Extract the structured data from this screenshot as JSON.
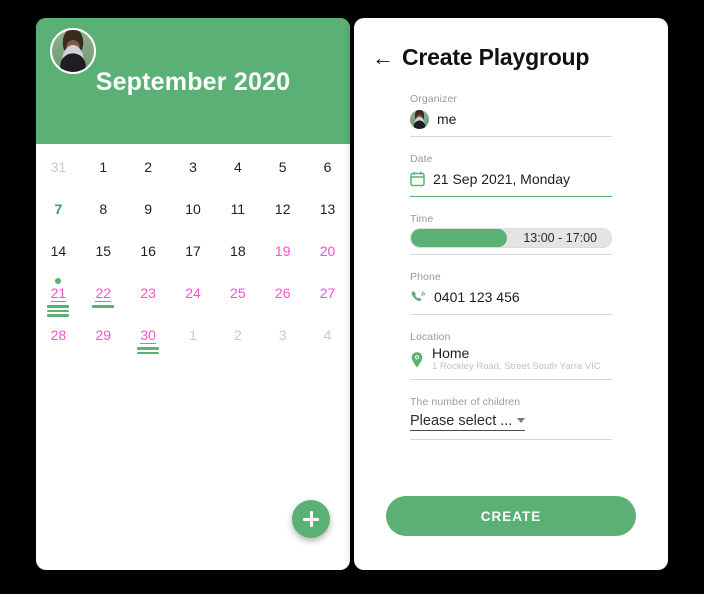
{
  "calendar": {
    "month_title": "September 2020",
    "avatar_name": "organizer-avatar",
    "add_button_label": "+",
    "weeks": [
      [
        {
          "n": "31",
          "style": "muted"
        },
        {
          "n": "1",
          "style": "normal"
        },
        {
          "n": "2",
          "style": "normal"
        },
        {
          "n": "3",
          "style": "normal"
        },
        {
          "n": "4",
          "style": "normal"
        },
        {
          "n": "5",
          "style": "normal"
        },
        {
          "n": "6",
          "style": "normal"
        }
      ],
      [
        {
          "n": "7",
          "style": "green"
        },
        {
          "n": "8",
          "style": "normal"
        },
        {
          "n": "9",
          "style": "normal"
        },
        {
          "n": "10",
          "style": "normal"
        },
        {
          "n": "11",
          "style": "normal"
        },
        {
          "n": "12",
          "style": "normal"
        },
        {
          "n": "13",
          "style": "normal"
        }
      ],
      [
        {
          "n": "14",
          "style": "normal"
        },
        {
          "n": "15",
          "style": "normal"
        },
        {
          "n": "16",
          "style": "normal"
        },
        {
          "n": "17",
          "style": "normal"
        },
        {
          "n": "18",
          "style": "normal"
        },
        {
          "n": "19",
          "style": "pink"
        },
        {
          "n": "20",
          "style": "pink"
        }
      ],
      [
        {
          "n": "21",
          "style": "pink",
          "underline": true,
          "dot": true,
          "bars": 3
        },
        {
          "n": "22",
          "style": "pink",
          "underline": true,
          "bars": 1
        },
        {
          "n": "23",
          "style": "pink"
        },
        {
          "n": "24",
          "style": "pink"
        },
        {
          "n": "25",
          "style": "pink"
        },
        {
          "n": "26",
          "style": "pink"
        },
        {
          "n": "27",
          "style": "pink"
        }
      ],
      [
        {
          "n": "28",
          "style": "pink"
        },
        {
          "n": "29",
          "style": "pink"
        },
        {
          "n": "30",
          "style": "pink",
          "underline": true,
          "bars": 2
        },
        {
          "n": "1",
          "style": "muted"
        },
        {
          "n": "2",
          "style": "muted"
        },
        {
          "n": "3",
          "style": "muted"
        },
        {
          "n": "4",
          "style": "muted"
        }
      ]
    ]
  },
  "form": {
    "back_label": "←",
    "title": "Create Playgroup",
    "organizer": {
      "label": "Organizer",
      "value": "me"
    },
    "date": {
      "label": "Date",
      "value": "21 Sep 2021, Monday"
    },
    "time": {
      "label": "Time",
      "value": "13:00 - 17:00",
      "fill_percent": 48
    },
    "phone": {
      "label": "Phone",
      "value": "0401 123 456"
    },
    "location": {
      "label": "Location",
      "name": "Home",
      "address": "1 Rockley Road, Street South Yarra VIC"
    },
    "children": {
      "label": "The number of children",
      "value": "Please select ..."
    },
    "submit_label": "CREATE"
  },
  "colors": {
    "green": "#5bb075",
    "pink": "#ff4fd0",
    "muted": "#c9c9c9",
    "background": "#000000"
  }
}
